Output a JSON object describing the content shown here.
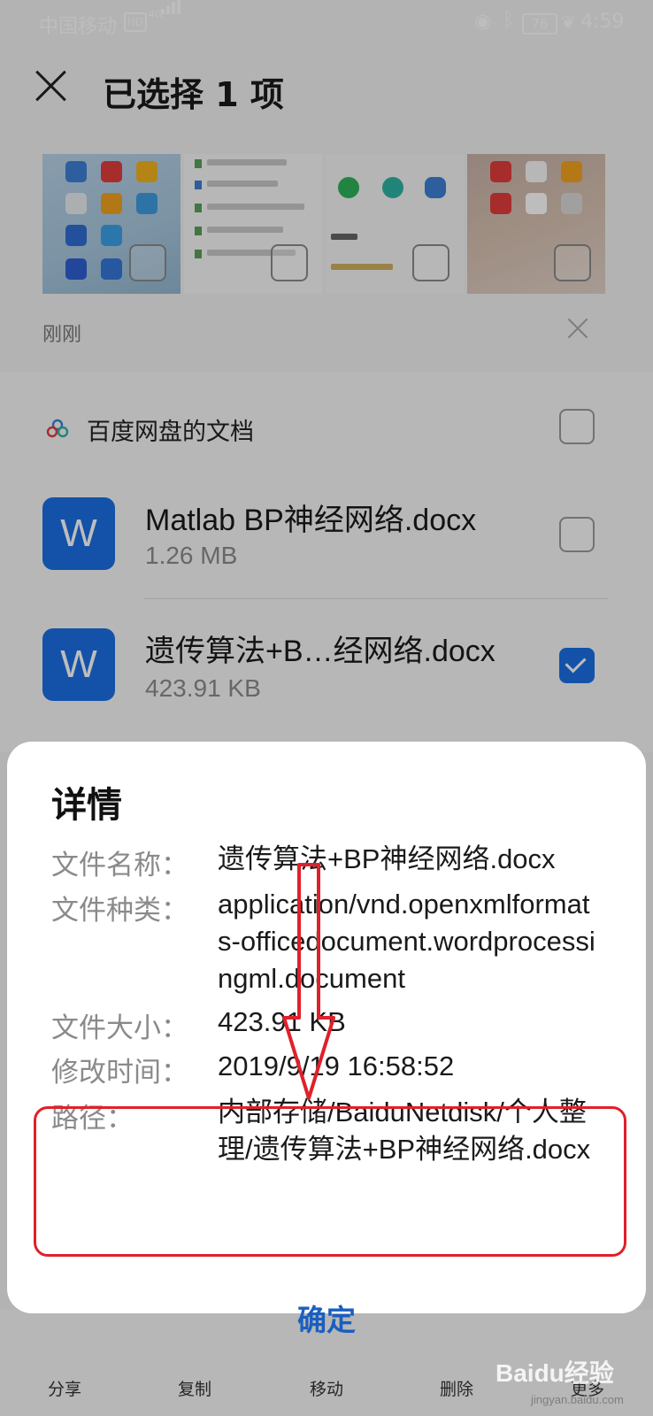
{
  "status_bar": {
    "carrier": "中国移动",
    "hd": "HD",
    "network": "4G",
    "battery": "76",
    "time": "4:59"
  },
  "header": {
    "title": "已选择 1 项"
  },
  "recent_label": "刚刚",
  "group": {
    "title": "百度网盘的文档"
  },
  "files": [
    {
      "icon_letter": "W",
      "name": "Matlab BP神经网络.docx",
      "size": "1.26 MB",
      "checked": false
    },
    {
      "icon_letter": "W",
      "name": "遗传算法+B…经网络.docx",
      "size": "423.91 KB",
      "checked": true
    }
  ],
  "bottom_bar": {
    "share": "分享",
    "copy": "复制",
    "move": "移动",
    "delete": "删除",
    "more": "更多"
  },
  "dialog": {
    "title": "详情",
    "rows": [
      {
        "label": "文件名称：",
        "value": "遗传算法+BP神经网络.docx"
      },
      {
        "label": "文件种类：",
        "value": "application/vnd.openxmlformats-officedocument.wordprocessingml.document"
      },
      {
        "label": "文件大小：",
        "value": "423.91 KB"
      },
      {
        "label": "修改时间：",
        "value": "2019/9/19 16:58:52"
      },
      {
        "label": "路径：",
        "value": "内部存储/BaiduNetdisk/个人整理/遗传算法+BP神经网络.docx"
      }
    ],
    "ok_label": "确定"
  },
  "watermark": {
    "brand": "Baidu经验",
    "url": "jingyan.baidu.com"
  },
  "colors": {
    "accent": "#1a6fe3",
    "annotation_red": "#e0202a",
    "ok_text": "#1a5fc0"
  }
}
